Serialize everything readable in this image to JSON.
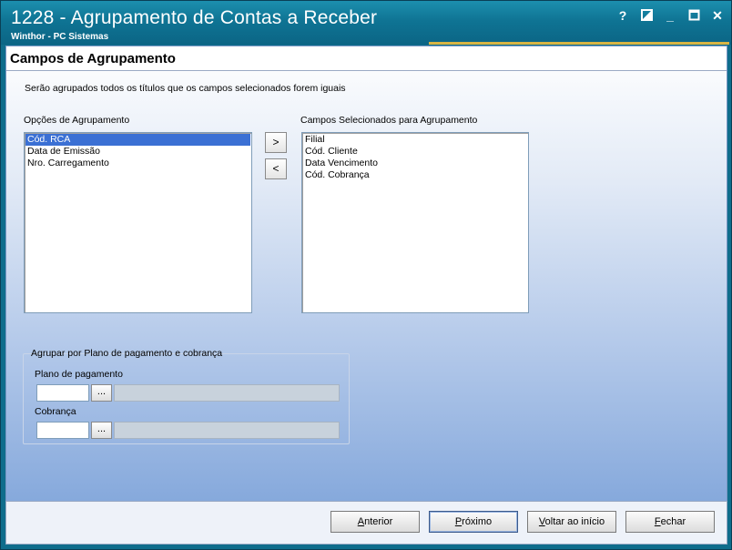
{
  "window": {
    "title": "1228 - Agrupamento de Contas a Receber",
    "subtitle": "Winthor - PC Sistemas",
    "controls": {
      "help": "?",
      "restore_icon": "restore-icon",
      "minimize": "_",
      "maximize_icon": "maximize-icon",
      "close": "✕"
    }
  },
  "page": {
    "title": "Campos de Agrupamento",
    "description": "Serão agrupados todos os títulos que os campos selecionados forem iguais"
  },
  "options": {
    "label": "Opções de Agrupamento",
    "items": [
      "Cód. RCA",
      "Data de Emissão",
      "Nro. Carregamento"
    ],
    "selected_index": 0
  },
  "selected": {
    "label": "Campos Selecionados para Agrupamento",
    "items": [
      "Filial",
      "Cód. Cliente",
      "Data Vencimento",
      "Cód. Cobrança"
    ]
  },
  "move_buttons": {
    "add": ">",
    "remove": "<"
  },
  "group": {
    "title": "Agrupar por Plano de pagamento e cobrança",
    "plano": {
      "label": "Plano de pagamento",
      "value": "",
      "button": "...",
      "description": ""
    },
    "cobranca": {
      "label": "Cobrança",
      "value": "",
      "button": "...",
      "description": ""
    }
  },
  "footer": {
    "anterior": {
      "accel": "A",
      "rest": "nterior"
    },
    "proximo": {
      "accel": "P",
      "rest": "róximo"
    },
    "voltar": {
      "accel": "V",
      "rest": "oltar ao início"
    },
    "fechar": {
      "accel": "F",
      "rest": "echar"
    }
  },
  "colors": {
    "titlebar": "#0f7494",
    "accent_line": "#d8b544",
    "selection": "#3b70d4"
  }
}
